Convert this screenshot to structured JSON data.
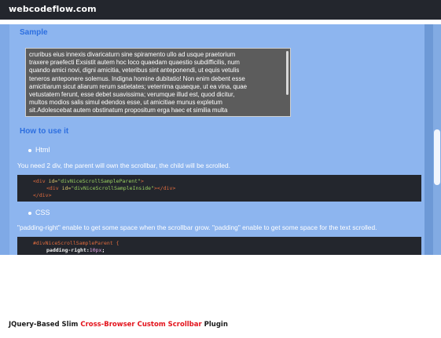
{
  "header": {
    "brand": "webcodeflow.com"
  },
  "sample": {
    "title": "Sample",
    "lines": [
      "cruribus eius innexis divaricaturn sine spiramento ullo ad usque praetorium",
      "traxere praefecti Exsistit autem hoc loco quaedam quaestio subdifficilis, num",
      "quando amici novi, digni amicitia, veteribus sint anteponendi, ut equis vetulis",
      "teneros anteponere solemus. Indigna homine dubitatio! Non enim debent esse",
      "amicitiarum sicut aliarum rerum satietates; veterrima quaeque, ut ea vina, quae",
      "vetustatem ferunt, esse debet suavissima; verumque illud est, quod dicitur,",
      "multos modios salis simul edendos esse, ut amicitiae munus expletum",
      "sit.Adolescebat autem obstinatum propositum erga haec et similia multa"
    ]
  },
  "howto": {
    "title": "How to use it",
    "html_label": "Html",
    "html_desc": "You need 2 div, the parent will own the scrollbar, the child will be scrolled.",
    "html_code": {
      "l1_tag_open": "<div",
      "l1_attr": " id=",
      "l1_str": "\"divNiceScrollSampleParent\"",
      "l1_tag_close": ">",
      "l2_tag_open": "<div",
      "l2_attr": " id=",
      "l2_str": "\"divNiceScrollSampleInside\"",
      "l2_tag_close": "></div>",
      "l3": "</div>"
    },
    "css_label": "CSS",
    "css_desc": "\"padding-right\" enable to get some space when the scrollbar grow. \"padding\" enable to get some space for the text scrolled.",
    "css_code": {
      "selector": "#divNiceScrollSampleParent {",
      "prop": "padding-right:",
      "value": "10px",
      "end": ";"
    }
  },
  "caption": {
    "part1": "JQuery-Based Slim ",
    "highlight": "Cross-Browser Custom Scrollbar",
    "part2": " Plugin"
  },
  "colors": {
    "accent_title": "#2d6fe0",
    "page_bg": "#7fa9e6",
    "caption_highlight": "#e3121b"
  }
}
